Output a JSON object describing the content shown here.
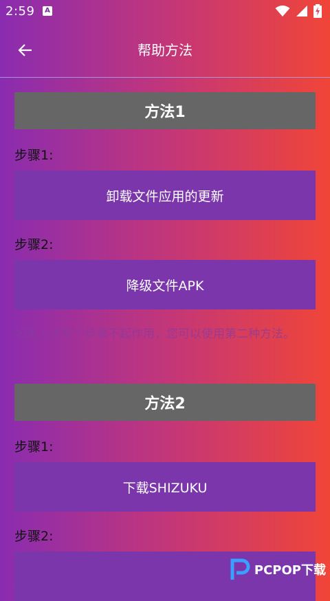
{
  "status_bar": {
    "time": "2:59",
    "badge": "A"
  },
  "app_bar": {
    "title": "帮助方法"
  },
  "method1": {
    "title": "方法1",
    "step1_label": "步骤1:",
    "step1_button": "卸载文件应用的更新",
    "step2_label": "步骤2:",
    "step2_button": "降级文件APK",
    "note": "如果上述两个步骤不起作用，您可以使用第二种方法。"
  },
  "method2": {
    "title": "方法2",
    "step1_label": "步骤1:",
    "step1_button": "下载SHIZUKU",
    "step2_label": "步骤2:"
  },
  "watermark": {
    "text": "PCPOP下载"
  },
  "icons": {
    "back": "arrow-left-icon",
    "wifi": "wifi-icon",
    "signal": "signal-icon",
    "battery": "battery-charging-icon"
  },
  "colors": {
    "gradient_start": "#8a2cb0",
    "gradient_end": "#f04538",
    "header_bg": "#666666",
    "button_bg": "#7a36aa"
  }
}
